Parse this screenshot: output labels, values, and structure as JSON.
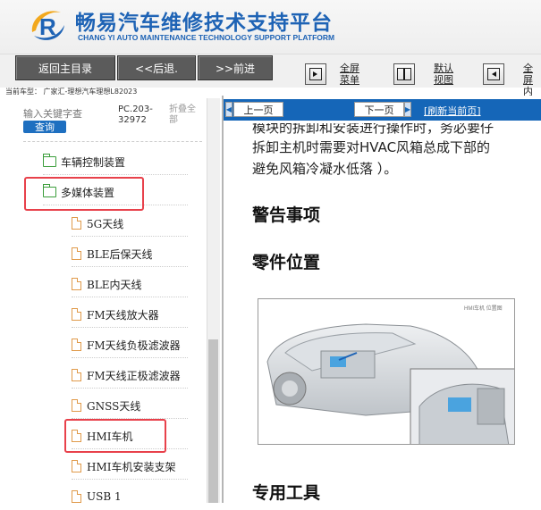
{
  "header": {
    "title": "畅易汽车维修技术支持平台",
    "subtitle": "CHANG YI AUTO MAINTENANCE TECHNOLOGY SUPPORT PLATFORM",
    "logo_letter": "R"
  },
  "toolbar": {
    "home_label": "返回主目录",
    "back_label": "<<后退.",
    "forward_label": ">>前进",
    "fullscreen_menu_label": "全屏\n菜单",
    "default_view_label": "默认\n视图",
    "fullscreen_content_label": "全屏\n内容"
  },
  "current_model": "当前车型： 广家汇-理想汽车理想L82023",
  "sidebar": {
    "search_placeholder": "输入关键字查",
    "search_button": "查询",
    "pc_code": "PC.203-\n32972",
    "collapse_all": "折叠全\n部",
    "items": [
      {
        "label": "车辆控制装置",
        "type": "folder"
      },
      {
        "label": "多媒体装置",
        "type": "folder"
      },
      {
        "label": "5G天线",
        "type": "doc"
      },
      {
        "label": "BLE后保天线",
        "type": "doc"
      },
      {
        "label": "BLE内天线",
        "type": "doc"
      },
      {
        "label": "FM天线放大器",
        "type": "doc"
      },
      {
        "label": "FM天线负极滤波器",
        "type": "doc"
      },
      {
        "label": "FM天线正极滤波器",
        "type": "doc"
      },
      {
        "label": "GNSS天线",
        "type": "doc"
      },
      {
        "label": "HMI车机",
        "type": "doc"
      },
      {
        "label": "HMI车机安装支架",
        "type": "doc"
      },
      {
        "label": "USB 1",
        "type": "doc"
      }
    ]
  },
  "content": {
    "prev_page": "上一页",
    "next_page": "下一页",
    "refresh": "[刷新当前页]",
    "top_partial_text": "模块的拆卸和安装进行操作时，务必要仔",
    "paragraph_line1": "拆卸主机时需要对HVAC风箱总成下部的",
    "paragraph_line2": "避免风箱冷凝水低落 ）。",
    "heading_warning": "警告事项",
    "heading_parts_location": "零件位置",
    "heading_special_tools": "专用工具",
    "figure_tag": "HMI车机 位置图"
  },
  "colors": {
    "brand_blue": "#1e63b5",
    "content_bar": "#1566b8",
    "highlight_red": "#e8414b",
    "folder_green": "#3a9d3a",
    "doc_orange": "#e09a4a"
  }
}
